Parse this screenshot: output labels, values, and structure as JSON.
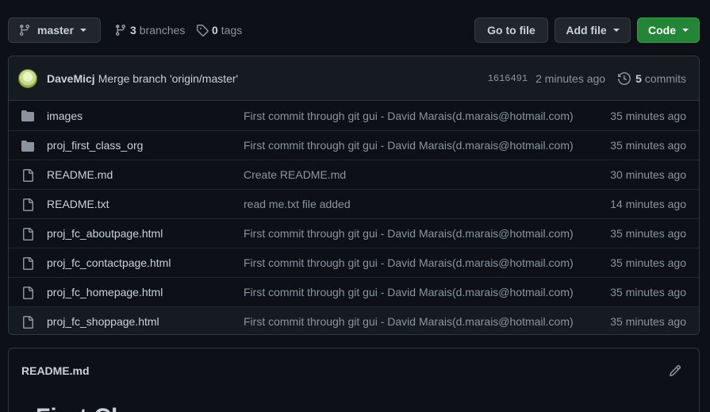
{
  "toolbar": {
    "branch_label": "master",
    "branches_count": "3",
    "branches_label": "branches",
    "tags_count": "0",
    "tags_label": "tags",
    "goto_label": "Go to file",
    "addfile_label": "Add file",
    "code_label": "Code"
  },
  "commit": {
    "author": "DaveMicj",
    "message": "Merge branch 'origin/master'",
    "sha": "1616491",
    "time": "2 minutes ago",
    "commits_count": "5",
    "commits_label": "commits"
  },
  "files": [
    {
      "type": "folder",
      "name": "images",
      "message": "First commit through git gui - David Marais(d.marais@hotmail.com)",
      "age": "35 minutes ago"
    },
    {
      "type": "folder",
      "name": "proj_first_class_org",
      "message": "First commit through git gui - David Marais(d.marais@hotmail.com)",
      "age": "35 minutes ago"
    },
    {
      "type": "file",
      "name": "README.md",
      "message": "Create README.md",
      "age": "30 minutes ago"
    },
    {
      "type": "file",
      "name": "README.txt",
      "message": "read me.txt file added",
      "age": "14 minutes ago"
    },
    {
      "type": "file",
      "name": "proj_fc_aboutpage.html",
      "message": "First commit through git gui - David Marais(d.marais@hotmail.com)",
      "age": "35 minutes ago"
    },
    {
      "type": "file",
      "name": "proj_fc_contactpage.html",
      "message": "First commit through git gui - David Marais(d.marais@hotmail.com)",
      "age": "35 minutes ago"
    },
    {
      "type": "file",
      "name": "proj_fc_homepage.html",
      "message": "First commit through git gui - David Marais(d.marais@hotmail.com)",
      "age": "35 minutes ago"
    },
    {
      "type": "file",
      "name": "proj_fc_shoppage.html",
      "message": "First commit through git gui - David Marais(d.marais@hotmail.com)",
      "age": "35 minutes ago"
    }
  ],
  "readme": {
    "title": "README.md",
    "heading": "First Class.org"
  },
  "colors": {
    "background": "#0d1117",
    "code_button": "#238636",
    "border": "#30363d"
  }
}
